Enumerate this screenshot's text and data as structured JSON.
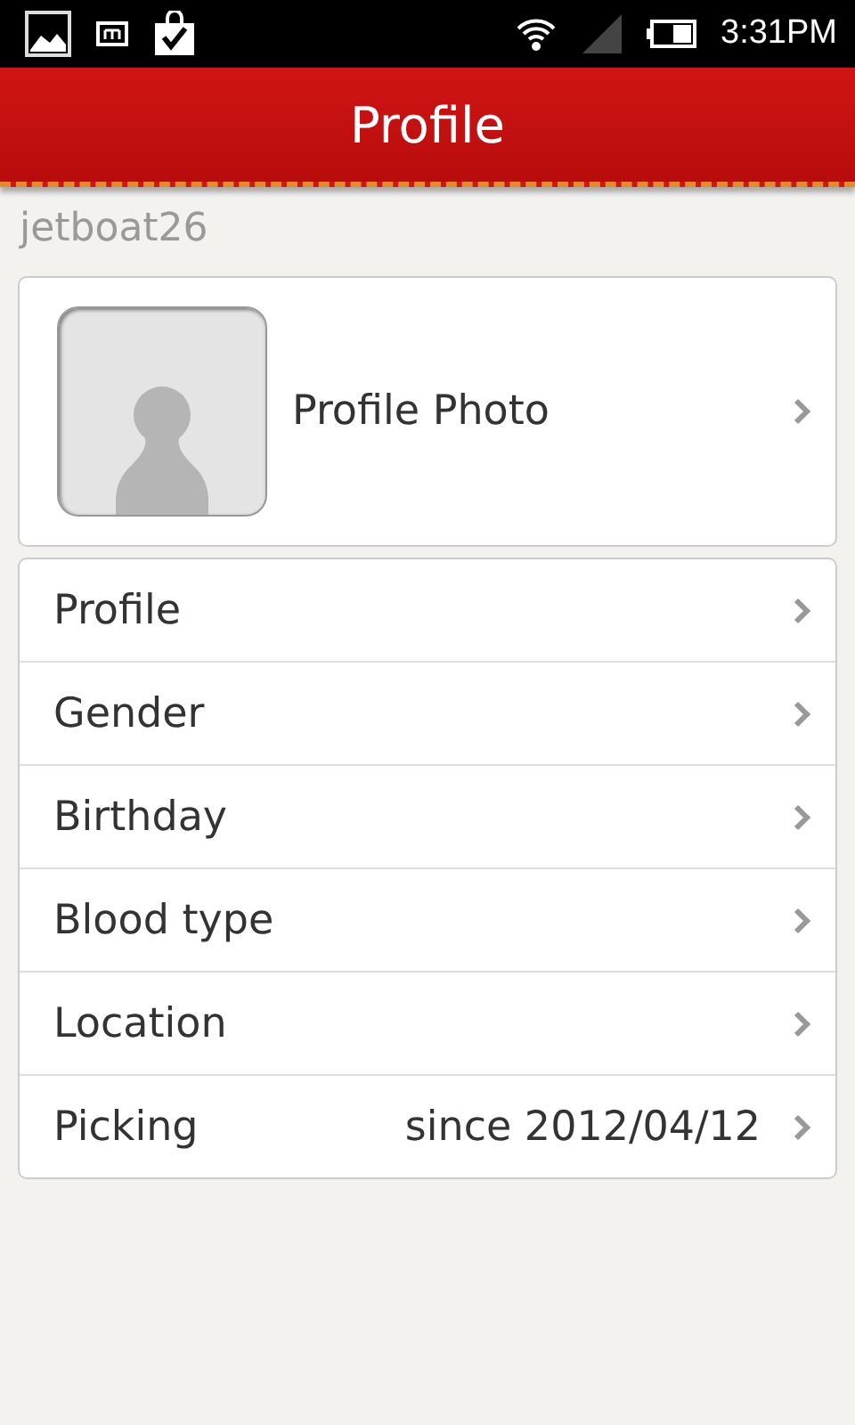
{
  "status_bar": {
    "time": "3:31PM"
  },
  "header": {
    "title": "Profile"
  },
  "username": "jetboat26",
  "photo_row": {
    "label": "Profile Photo"
  },
  "items": [
    {
      "label": "Profile"
    },
    {
      "label": "Gender"
    },
    {
      "label": "Birthday"
    },
    {
      "label": "Blood type"
    },
    {
      "label": "Location"
    },
    {
      "label": "Picking",
      "value": "since 2012/04/12"
    }
  ]
}
